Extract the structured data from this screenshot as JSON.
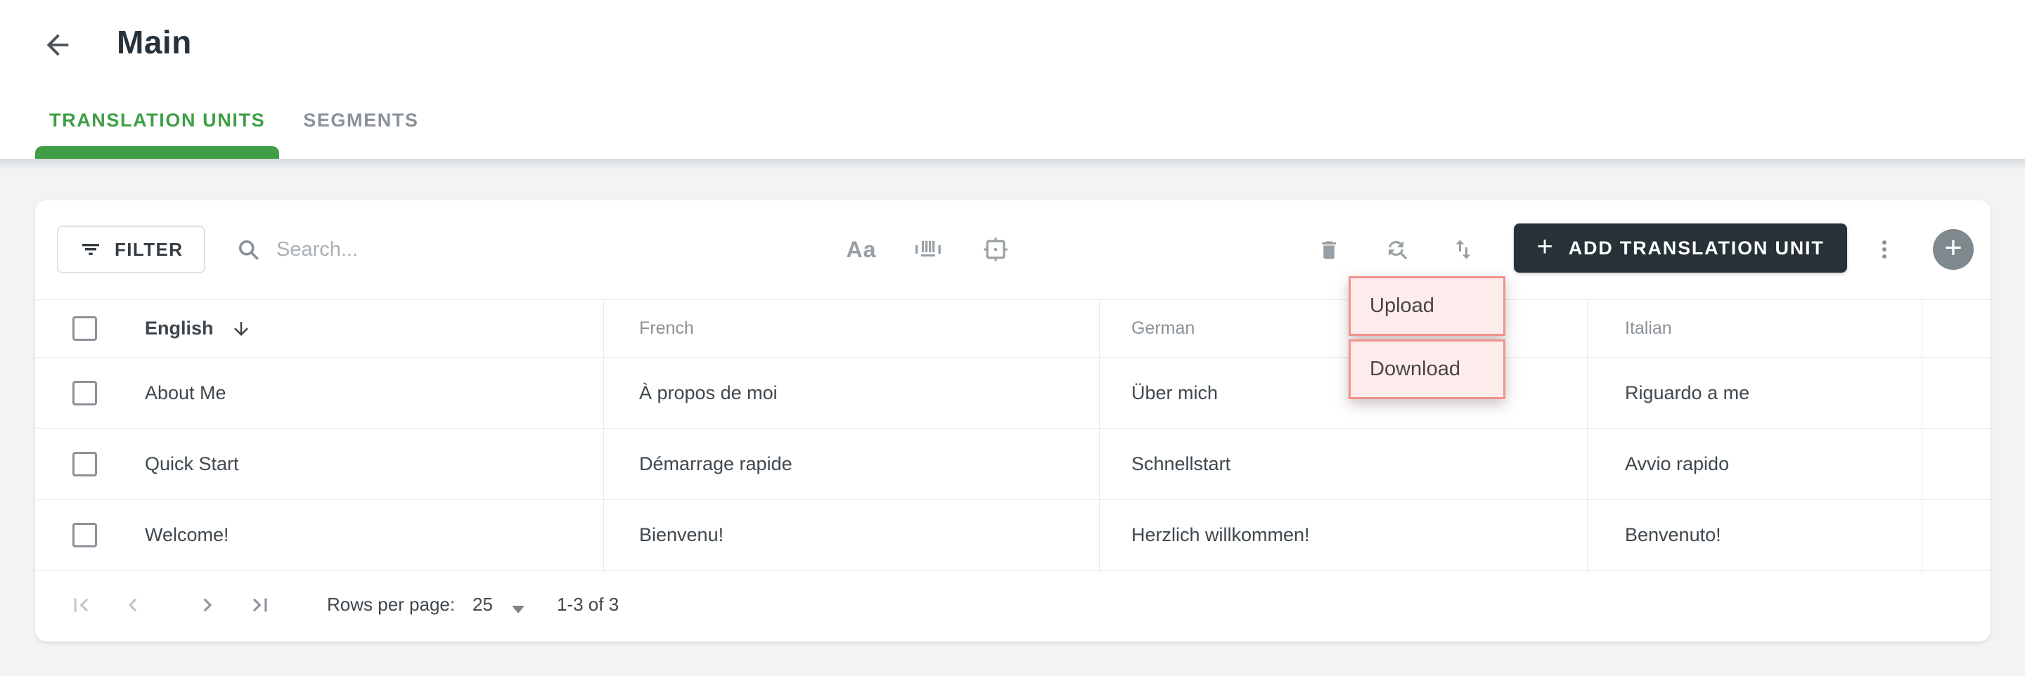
{
  "header": {
    "title": "Main",
    "back_icon": "arrow-left-icon"
  },
  "tabs": {
    "translation_units": "TRANSLATION UNITS",
    "segments": "SEGMENTS"
  },
  "toolbar": {
    "filter_label": "FILTER",
    "search_placeholder": "Search...",
    "text_case_icon_label": "Aa",
    "icons": [
      "filter-icon",
      "search-icon",
      "text-case-icon",
      "barcode-icon",
      "focus-frame-icon",
      "trash-icon",
      "find-replace-icon",
      "import-export-icon",
      "more-vert-icon",
      "plus-circle-icon"
    ],
    "add_button_label": "ADD TRANSLATION UNIT",
    "add_button_plus": "+"
  },
  "export_menu": {
    "items": [
      {
        "label": "Upload"
      },
      {
        "label": "Download"
      }
    ]
  },
  "table": {
    "columns": [
      "English",
      "French",
      "German",
      "Italian"
    ],
    "sorted_column": "English",
    "sort_icon": "arrow-down-icon",
    "rows": [
      [
        "About Me",
        "À propos de moi",
        "Über mich",
        "Riguardo a me"
      ],
      [
        "Quick Start",
        "Démarrage rapide",
        "Schnellstart",
        "Avvio rapido"
      ],
      [
        "Welcome!",
        "Bienvenu!",
        "Herzlich willkommen!",
        "Benvenuto!"
      ]
    ]
  },
  "pagination": {
    "rows_per_page_label": "Rows per page:",
    "rows_per_page_value": "25",
    "range_label": "1-3 of 3",
    "icons": [
      "first-page-icon",
      "prev-page-icon",
      "next-page-icon",
      "last-page-icon"
    ]
  },
  "colors": {
    "accent_green": "#3f9e45",
    "dark_button": "#263238",
    "page_background": "#f1f3f4",
    "icon_gray": "#8a9297",
    "menu_highlight_bg": "#fdeceb",
    "menu_highlight_border": "#f1928c"
  }
}
